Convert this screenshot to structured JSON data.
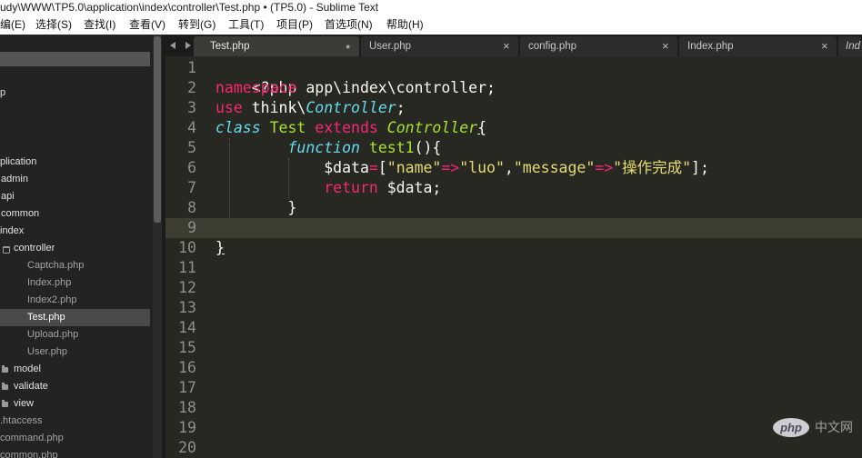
{
  "window": {
    "title": "udy\\WWW\\TP5.0\\application\\index\\controller\\Test.php • (TP5.0) - Sublime Text"
  },
  "menu": [
    "编(E)",
    "选择(S)",
    "查找(I)",
    "查看(V)",
    "转到(G)",
    "工具(T)",
    "项目(P)",
    "首选项(N)",
    "帮助(H)"
  ],
  "tab_scroll": {
    "left_icon": "triangle-left-icon",
    "right_icon": "triangle-right-icon"
  },
  "tabs": [
    {
      "label": "Test.php",
      "indicator": "●",
      "active": true
    },
    {
      "label": "User.php",
      "indicator": "×"
    },
    {
      "label": "config.php",
      "indicator": "×"
    },
    {
      "label": "Index.php",
      "indicator": "×"
    },
    {
      "label": "Ind"
    }
  ],
  "sidebar": {
    "items": [
      {
        "label": "p"
      },
      {
        "label": "plication"
      },
      {
        "label": "admin"
      },
      {
        "label": "api"
      },
      {
        "label": "common"
      },
      {
        "label": "index"
      },
      {
        "label": "controller",
        "icon": "folder-open-icon"
      },
      {
        "label": "Captcha.php"
      },
      {
        "label": "Index.php"
      },
      {
        "label": "Index2.php"
      },
      {
        "label": "Test.php",
        "selected": true
      },
      {
        "label": "Upload.php"
      },
      {
        "label": "User.php"
      },
      {
        "label": "model",
        "icon": "folder-icon"
      },
      {
        "label": "validate",
        "icon": "folder-icon"
      },
      {
        "label": "view",
        "icon": "folder-icon"
      },
      {
        "label": ".htaccess"
      },
      {
        "label": "command.php"
      },
      {
        "label": "common.php"
      }
    ]
  },
  "editor": {
    "current_line": 9,
    "line_numbers": [
      "1",
      "2",
      "3",
      "4",
      "5",
      "6",
      "7",
      "8",
      "9",
      "10",
      "11",
      "12",
      "13",
      "14",
      "15",
      "16",
      "17",
      "18",
      "19",
      "20"
    ],
    "lines": [
      [
        "<?php"
      ],
      [
        "namespace",
        " app\\index\\controller;"
      ],
      [
        "use",
        " think\\",
        "Controller",
        ";"
      ],
      [
        "class",
        " Test",
        " extends",
        " Controller",
        "{"
      ],
      [
        "        function",
        " test1",
        "(){"
      ],
      [
        "            $data",
        "=",
        "[",
        "\"name\"",
        "=>",
        "\"luo\"",
        ",",
        "\"message\"",
        "=>",
        "\"操作完成\"",
        "];"
      ],
      [
        "            return",
        " $data;"
      ],
      [
        "        }"
      ],
      [],
      [
        "}"
      ]
    ]
  },
  "watermark": {
    "logo": "php",
    "text": "中文网"
  },
  "colors": {
    "editor_bg": "#272822",
    "current_line_bg": "#3e3d32",
    "text": "#f8f8f2",
    "keyword": "#f92672",
    "storage": "#66d9ef",
    "entity": "#a6e22e",
    "string": "#e6db74",
    "line_number": "#90908a"
  }
}
